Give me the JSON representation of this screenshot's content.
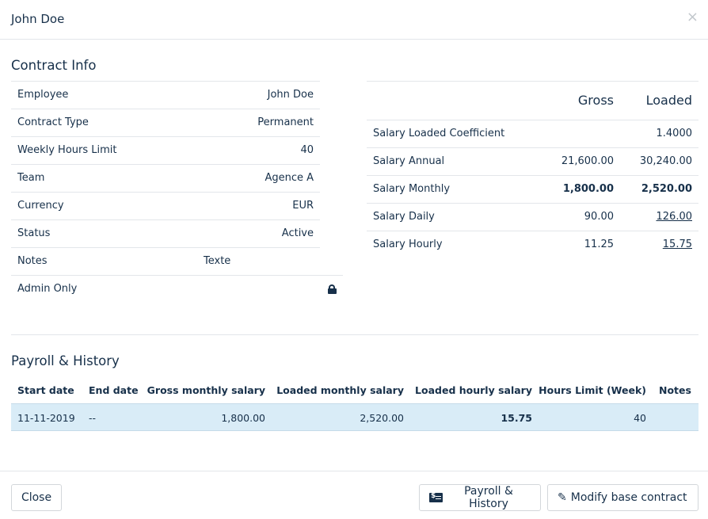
{
  "header": {
    "title": "John Doe",
    "close_glyph": "×"
  },
  "contract": {
    "title": "Contract Info",
    "rows": [
      {
        "label": "Employee",
        "value": "John Doe"
      },
      {
        "label": "Contract Type",
        "value": "Permanent"
      },
      {
        "label": "Weekly Hours Limit",
        "value": "40"
      },
      {
        "label": "Team",
        "value": "Agence A"
      },
      {
        "label": "Currency",
        "value": "EUR"
      },
      {
        "label": "Status",
        "value": "Active"
      },
      {
        "label": "Notes",
        "value": "Texte"
      },
      {
        "label": "Admin Only",
        "value_icon": "unlocked-lock-icon"
      }
    ]
  },
  "salary": {
    "col_gross": "Gross",
    "col_loaded": "Loaded",
    "rows": [
      {
        "label": "Salary Loaded Coefficient",
        "gross": "",
        "loaded": "1.4000"
      },
      {
        "label": "Salary Annual",
        "gross": "21,600.00",
        "loaded": "30,240.00"
      },
      {
        "label": "Salary Monthly",
        "gross": "1,800.00",
        "loaded": "2,520.00"
      },
      {
        "label": "Salary Daily",
        "gross": "90.00",
        "loaded": "126.00"
      },
      {
        "label": "Salary Hourly",
        "gross": "11.25",
        "loaded": "15.75"
      }
    ]
  },
  "payroll": {
    "title": "Payroll & History",
    "columns": [
      "Start date",
      "End date",
      "Gross monthly salary",
      "Loaded monthly salary",
      "Loaded hourly salary",
      "Hours Limit (Week)",
      "Notes"
    ],
    "rows": [
      {
        "start": "11-11-2019",
        "end": "--",
        "gross_monthly": "1,800.00",
        "loaded_monthly": "2,520.00",
        "loaded_hourly": "15.75",
        "hours_limit": "40",
        "notes": ""
      }
    ]
  },
  "footer": {
    "close_label": "Close",
    "payroll_label": "Payroll & History",
    "modify_label": "Modify base contract",
    "pencil_glyph": "✎"
  }
}
